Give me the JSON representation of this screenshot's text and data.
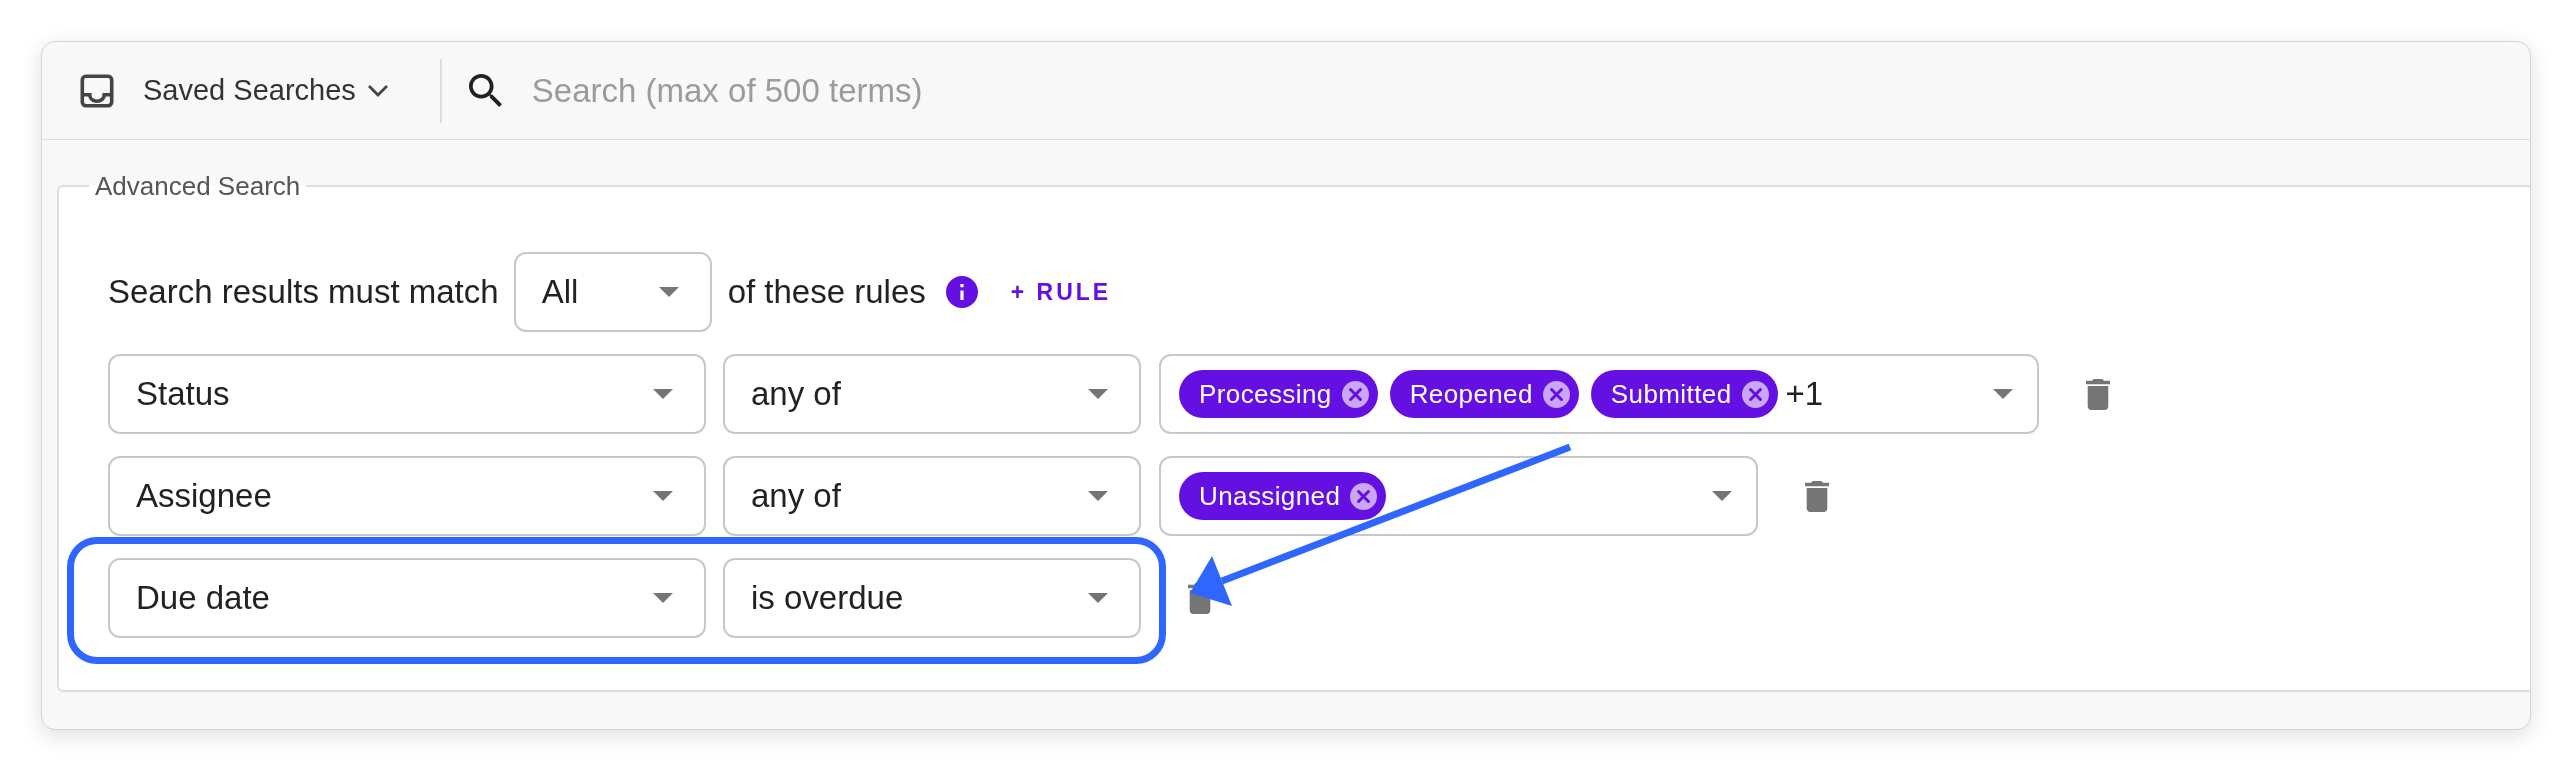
{
  "toolbar": {
    "saved_searches": {
      "label": "Saved Searches"
    },
    "search": {
      "placeholder": "Search (max of 500 terms)"
    }
  },
  "advanced_search": {
    "legend": "Advanced Search",
    "match": {
      "prefix": "Search results must match",
      "value": "All",
      "suffix": "of these rules"
    },
    "add_rule": "+ RULE",
    "rules": [
      {
        "field": "Status",
        "operator": "any of",
        "values": [
          "Processing",
          "Reopened",
          "Submitted"
        ],
        "more": "+1",
        "highlighted": false
      },
      {
        "field": "Assignee",
        "operator": "any of",
        "values": [
          "Unassigned"
        ],
        "highlighted": false
      },
      {
        "field": "Due date",
        "operator": "is overdue",
        "highlighted": true
      }
    ]
  }
}
